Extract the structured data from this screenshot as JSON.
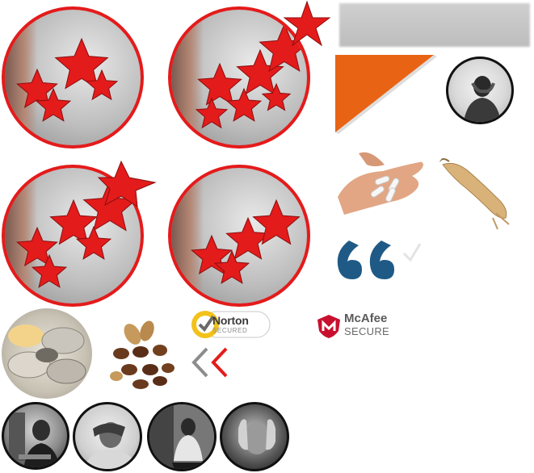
{
  "badges": {
    "norton_label": "Norton",
    "norton_sub": "SECURED",
    "mcafee_label": "McAfee",
    "mcafee_sub": "SECURE"
  },
  "colors": {
    "accent_red": "#e41b1b",
    "accent_orange": "#e86414",
    "quote_blue": "#1f5a86"
  },
  "icons": [
    "star-icon",
    "quote-icon",
    "checkmark-icon",
    "chevron-left-icon",
    "norton-check-icon",
    "mcafee-shield-icon"
  ]
}
